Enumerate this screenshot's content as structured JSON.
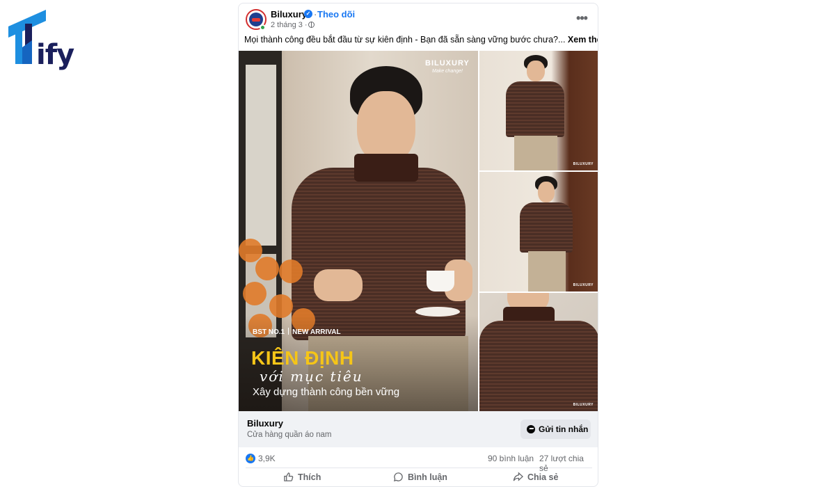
{
  "logo": {
    "text": "ify"
  },
  "post": {
    "page_name": "Biluxury",
    "follow_label": "Theo dõi",
    "date": "2 tháng 3 ·",
    "caption": "Mọi thành công đều bắt đầu từ sự kiên định - Bạn đã sẵn sàng vững bước chưa?...",
    "see_more": "Xem thêm"
  },
  "image": {
    "brand_mark": "BILUXURY",
    "brand_tagline": "Make change!",
    "badge_left": "BST NO.1",
    "badge_right": "NEW ARRIVAL",
    "headline": "KIÊN ĐỊNH",
    "headline_script": "với mục tiêu",
    "headline_sub": "Xây dựng thành công bền vững",
    "thumb_brand": "BILUXURY"
  },
  "cta": {
    "name": "Biluxury",
    "description": "Cửa hàng quần áo nam",
    "button_label": "Gửi tin nhắn"
  },
  "stats": {
    "reactions": "3,9K",
    "comments": "90 bình luận",
    "shares": "27 lượt chia sẻ"
  },
  "actions": {
    "like": "Thích",
    "comment": "Bình luận",
    "share": "Chia sẻ"
  },
  "colors": {
    "facebook_blue": "#1877f2",
    "headline_yellow": "#f5c518",
    "shirt_brown": "#4a2e25"
  }
}
